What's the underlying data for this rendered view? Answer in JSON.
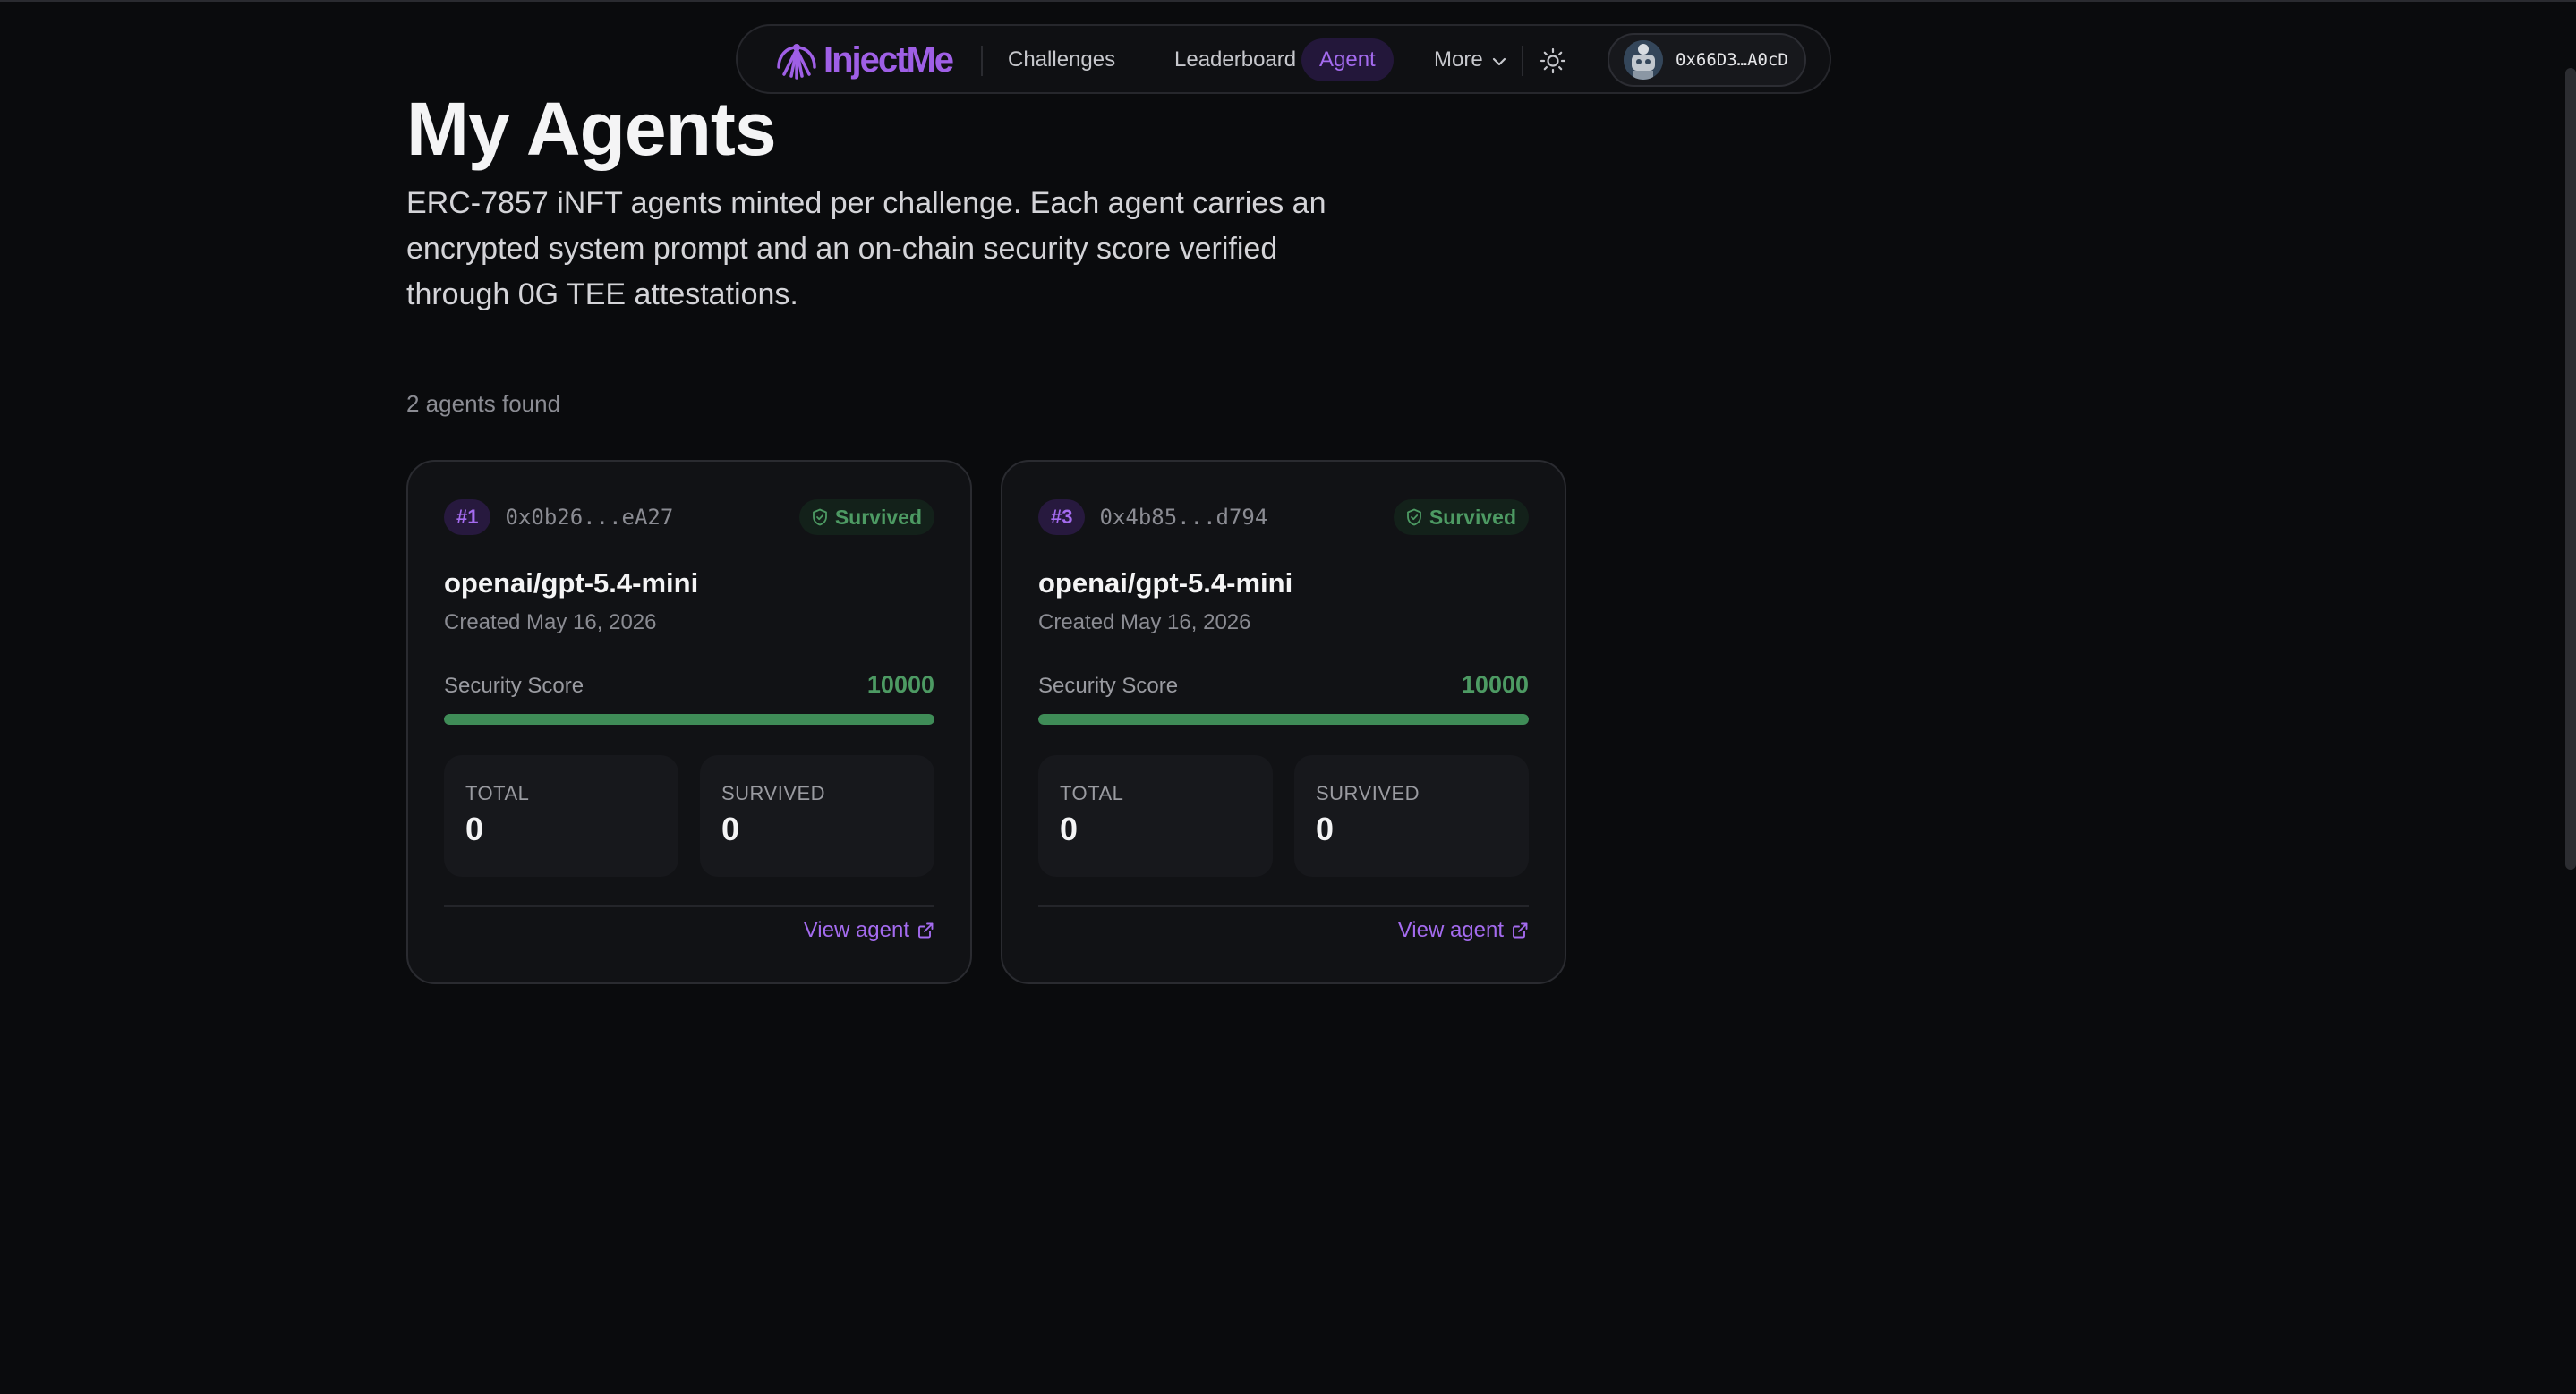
{
  "nav": {
    "logo_text": "InjectMe",
    "links": [
      {
        "label": "Challenges",
        "active": false
      },
      {
        "label": "Leaderboard",
        "active": false
      },
      {
        "label": "Agent",
        "active": true
      }
    ],
    "more_label": "More",
    "theme_icon": "sun-icon",
    "wallet_address": "0x66D3…A0cD",
    "accent_color": "#a46bef"
  },
  "header": {
    "title": "My Agents",
    "description": "ERC-7857 iNFT agents minted per challenge. Each agent carries an encrypted system prompt and an on-chain security score verified through 0G TEE attestations.",
    "count_text": "2 agents found"
  },
  "agents": [
    {
      "id": "#1",
      "address": "0x0b26...eA27",
      "status": "Survived",
      "model": "openai/gpt-5.4-mini",
      "created": "Created May 16, 2026",
      "score_label": "Security Score",
      "score": "10000",
      "score_fill_fraction": 1.0,
      "total_label": "TOTAL",
      "total": "0",
      "survived_label": "SURVIVED",
      "survived": "0",
      "view_label": "View agent"
    },
    {
      "id": "#3",
      "address": "0x4b85...d794",
      "status": "Survived",
      "model": "openai/gpt-5.4-mini",
      "created": "Created May 16, 2026",
      "score_label": "Security Score",
      "score": "10000",
      "score_fill_fraction": 1.0,
      "total_label": "TOTAL",
      "total": "0",
      "survived_label": "SURVIVED",
      "survived": "0",
      "view_label": "View agent"
    }
  ],
  "colors": {
    "survived_green": "#4d9a63",
    "background": "#0a0b0d"
  }
}
